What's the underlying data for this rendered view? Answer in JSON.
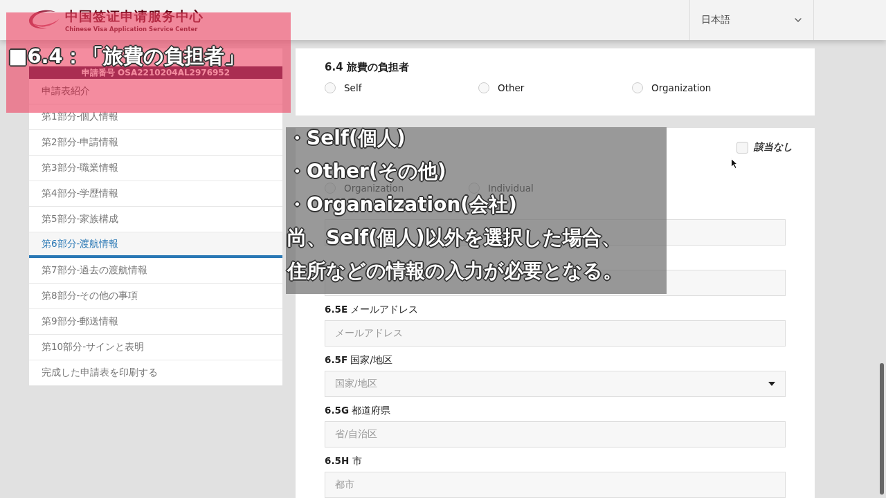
{
  "header": {
    "logo_title": "中国签证申请服务中心",
    "logo_subtitle": "Chinese Visa Application Service Center",
    "language": "日本語"
  },
  "sidebar": {
    "application_number": "申請番号 OSA2210204AL2976952",
    "items": [
      {
        "label": "申請表紹介",
        "selected": false
      },
      {
        "label": "第1部分-個人情報",
        "selected": false
      },
      {
        "label": "第2部分-申請情報",
        "selected": false
      },
      {
        "label": "第3部分-職業情報",
        "selected": false
      },
      {
        "label": "第4部分-学歴情報",
        "selected": false
      },
      {
        "label": "第5部分-家族構成",
        "selected": false
      },
      {
        "label": "第6部分-渡航情報",
        "selected": true
      },
      {
        "label": "第7部分-過去の渡航情報",
        "selected": false
      },
      {
        "label": "第8部分-その他の事項",
        "selected": false
      },
      {
        "label": "第9部分-郵送情報",
        "selected": false
      },
      {
        "label": "第10部分-サインと表明",
        "selected": false
      },
      {
        "label": "完成した申請表を印刷する",
        "selected": false
      }
    ]
  },
  "sections": [
    {
      "title": "6.4 旅費の負担者",
      "options": [
        {
          "label": "Self",
          "selected": false
        },
        {
          "label": "Other",
          "selected": false
        },
        {
          "label": "Organization",
          "selected": false
        }
      ]
    },
    {
      "not_applicable": {
        "label": "該当なし",
        "checked": false
      },
      "options": [
        {
          "label": "Organization",
          "selected": false
        },
        {
          "label": "Individual",
          "selected": false
        }
      ],
      "fields": [
        {
          "kind": "text"
        },
        {
          "kind": "text"
        },
        {
          "kind": "text",
          "label": "**6.5E** メールアドレス",
          "placeholder": "メールアドレス"
        },
        {
          "kind": "select",
          "label": "**6.5F** 国家/地区",
          "placeholder": "国家/地区"
        },
        {
          "kind": "text",
          "label": "**6.5G** 都道府県",
          "placeholder": "省/自治区"
        },
        {
          "kind": "text",
          "label": "**6.5H** 市",
          "placeholder": "都市"
        }
      ]
    }
  ],
  "captions": {
    "title": "■6.4：「旅費の負担者」",
    "lines": [
      "・Self(個人)",
      "・Other(その他)",
      "・Organaization(会社)",
      "尚、Self(個人)以外を選択した場合、",
      "住所などの情報の入力が必要となる。"
    ]
  }
}
